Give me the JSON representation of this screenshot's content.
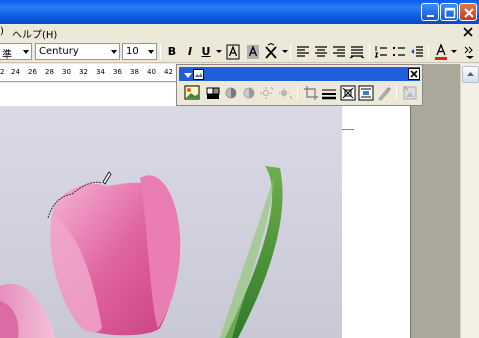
{
  "menubar": {
    "items": [
      {
        "label": ")"
      },
      {
        "label": "ヘルプ(H)"
      }
    ]
  },
  "format": {
    "style_value": "準",
    "font_value": "Century",
    "size_value": "10",
    "bold_label": "B",
    "italic_label": "I",
    "underline_label": "U"
  },
  "ruler": {
    "ticks": [
      "2",
      "24",
      "26",
      "28",
      "30",
      "32",
      "34",
      "36",
      "38",
      "40",
      "42"
    ]
  },
  "picture_toolbar": {
    "button_icons": [
      "insert-picture-icon",
      "color-icon",
      "more-contrast-icon",
      "less-contrast-icon",
      "more-brightness-icon",
      "less-brightness-icon",
      "crop-icon",
      "line-style-icon",
      "compress-icon",
      "text-wrapping-icon",
      "format-picture-icon",
      "set-transparent-color-icon",
      "reset-picture-icon"
    ]
  },
  "colors": {
    "title_bar": "#0a5ee8",
    "font_color_bar": "#e02020",
    "toolbar_bg": "#ece9d8"
  }
}
